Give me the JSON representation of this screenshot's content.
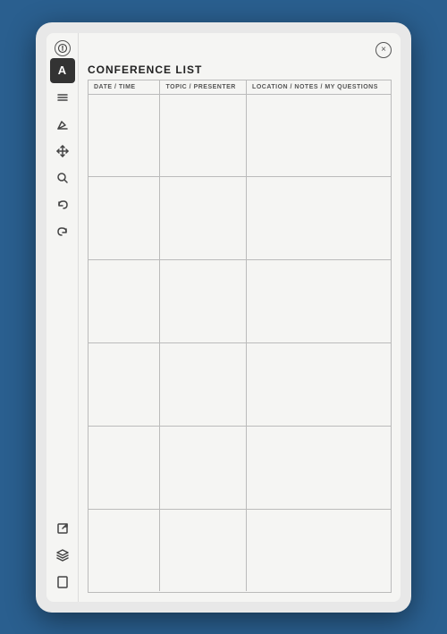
{
  "device": {
    "title": "CONFERENCE LIST"
  },
  "header": {
    "title": "CONFERENCE LIST",
    "close_label": "×",
    "info_label": "i"
  },
  "table": {
    "columns": [
      {
        "label": "DATE / TIME"
      },
      {
        "label": "TOPIC / PRESENTER"
      },
      {
        "label": "LOCATION / NOTES / MY QUESTIONS"
      }
    ],
    "rows": [
      {
        "date": "",
        "topic": "",
        "notes": ""
      },
      {
        "date": "",
        "topic": "",
        "notes": ""
      },
      {
        "date": "",
        "topic": "",
        "notes": ""
      },
      {
        "date": "",
        "topic": "",
        "notes": ""
      },
      {
        "date": "",
        "topic": "",
        "notes": ""
      },
      {
        "date": "",
        "topic": "",
        "notes": ""
      }
    ]
  },
  "sidebar": {
    "top_icon_label": "A",
    "icons": [
      {
        "name": "menu",
        "unicode": "≡"
      },
      {
        "name": "eraser",
        "unicode": "◇"
      },
      {
        "name": "move",
        "unicode": "⊕"
      },
      {
        "name": "search",
        "unicode": "⌕"
      },
      {
        "name": "undo",
        "unicode": "↩"
      },
      {
        "name": "redo",
        "unicode": "↪"
      }
    ],
    "bottom_icons": [
      {
        "name": "export",
        "unicode": "⬡"
      },
      {
        "name": "layers",
        "unicode": "⊞"
      },
      {
        "name": "page",
        "unicode": "□"
      }
    ]
  }
}
